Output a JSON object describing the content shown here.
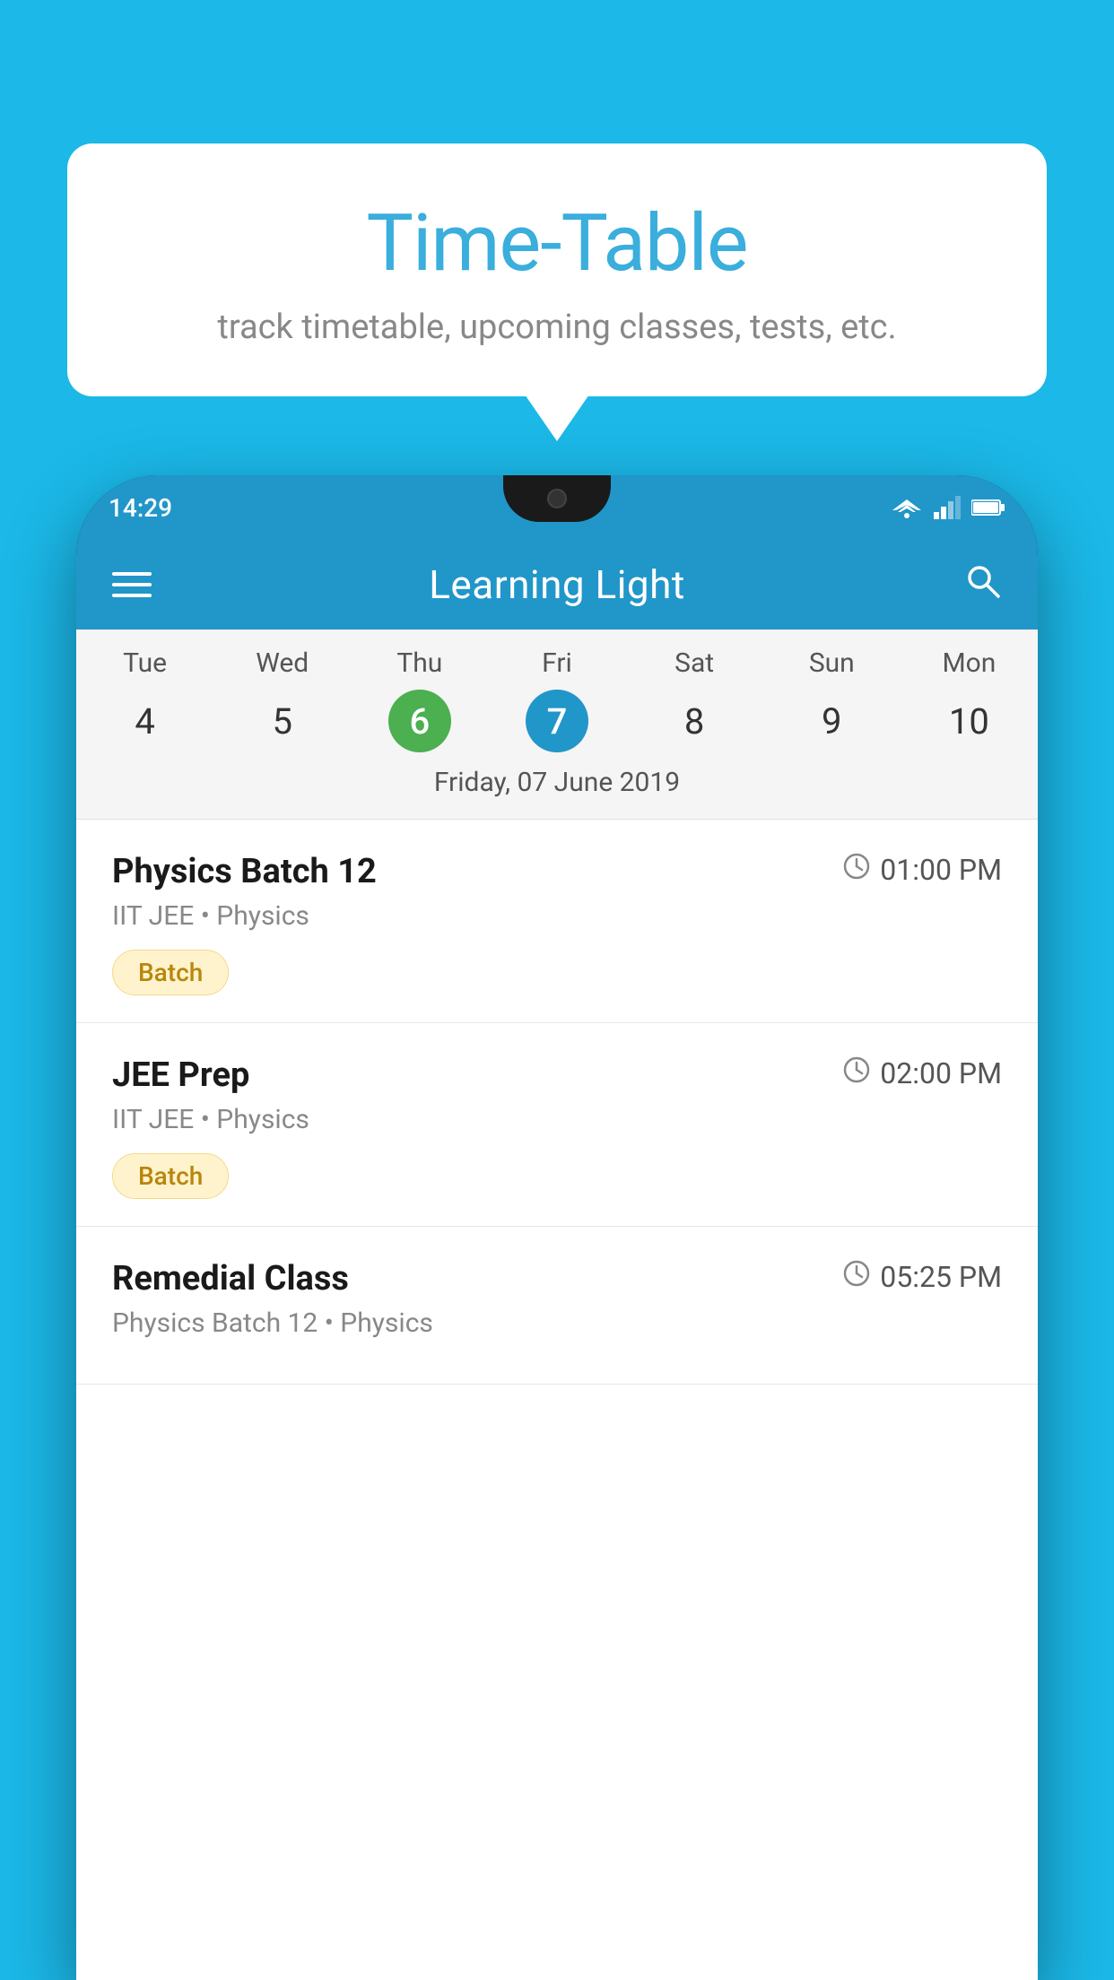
{
  "background_color": "#1BB8E8",
  "bubble": {
    "title": "Time-Table",
    "subtitle": "track timetable, upcoming classes, tests, etc."
  },
  "phone": {
    "status_bar": {
      "time": "14:29"
    },
    "app_header": {
      "title": "Learning Light"
    },
    "calendar": {
      "days": [
        "Tue",
        "Wed",
        "Thu",
        "Fri",
        "Sat",
        "Sun",
        "Mon"
      ],
      "dates": [
        "4",
        "5",
        "6",
        "7",
        "8",
        "9",
        "10"
      ],
      "today_index": 2,
      "selected_index": 3,
      "selected_date_label": "Friday, 07 June 2019"
    },
    "schedule_items": [
      {
        "name": "Physics Batch 12",
        "time": "01:00 PM",
        "meta": "IIT JEE • Physics",
        "badge": "Batch"
      },
      {
        "name": "JEE Prep",
        "time": "02:00 PM",
        "meta": "IIT JEE • Physics",
        "badge": "Batch"
      },
      {
        "name": "Remedial Class",
        "time": "05:25 PM",
        "meta": "Physics Batch 12 • Physics",
        "badge": null
      }
    ]
  }
}
